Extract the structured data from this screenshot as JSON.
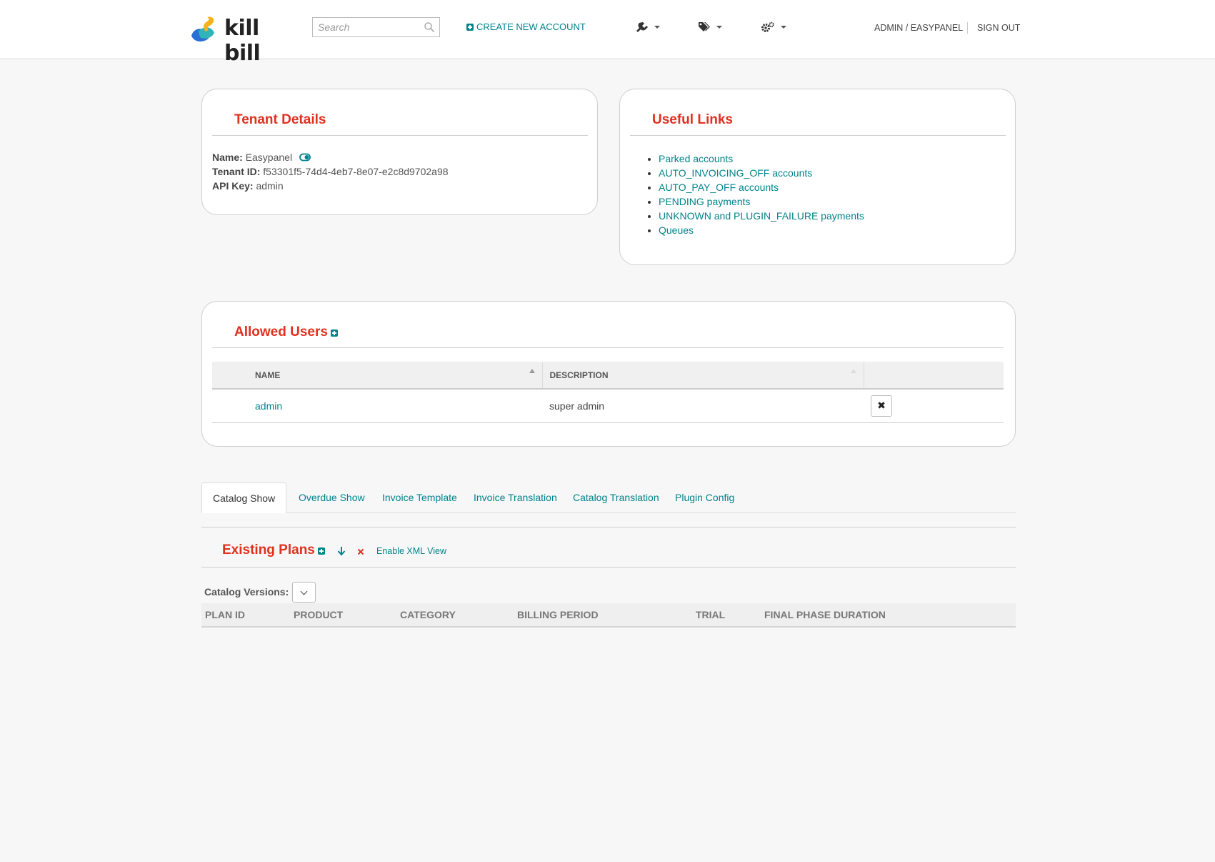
{
  "header": {
    "logo_text": "kill bill",
    "search_placeholder": "Search",
    "create_account_label": "CREATE NEW ACCOUNT",
    "menus": [
      {
        "icon": "plug-icon"
      },
      {
        "icon": "tags-icon"
      },
      {
        "icon": "gears-icon"
      }
    ],
    "user_label": "ADMIN / EASYPANEL",
    "signout_label": "SIGN OUT"
  },
  "tenant_details": {
    "title": "Tenant Details",
    "name_label": "Name:",
    "name_value": "Easypanel",
    "id_label": "Tenant ID:",
    "id_value": "f53301f5-74d4-4eb7-8e07-e2c8d9702a98",
    "apikey_label": "API Key:",
    "apikey_value": "admin"
  },
  "useful_links": {
    "title": "Useful Links",
    "items": [
      "Parked accounts",
      "AUTO_INVOICING_OFF accounts",
      "AUTO_PAY_OFF accounts",
      "PENDING payments",
      "UNKNOWN and PLUGIN_FAILURE payments",
      "Queues"
    ]
  },
  "allowed_users": {
    "title": "Allowed Users",
    "columns": [
      "NAME",
      "DESCRIPTION"
    ],
    "rows": [
      {
        "name": "admin",
        "description": "super admin"
      }
    ]
  },
  "tabs": [
    {
      "label": "Catalog Show",
      "active": true
    },
    {
      "label": "Overdue Show"
    },
    {
      "label": "Invoice Template"
    },
    {
      "label": "Invoice Translation"
    },
    {
      "label": "Catalog Translation"
    },
    {
      "label": "Plugin Config"
    }
  ],
  "plans": {
    "title": "Existing Plans",
    "xml_link": "Enable XML View",
    "catalog_versions_label": "Catalog Versions:",
    "columns": [
      "PLAN ID",
      "PRODUCT",
      "CATEGORY",
      "BILLING PERIOD",
      "TRIAL",
      "FINAL PHASE DURATION"
    ]
  },
  "colors": {
    "accent": "#00838a",
    "title_red": "#e0301e",
    "page_bg": "#f7f7f7"
  }
}
